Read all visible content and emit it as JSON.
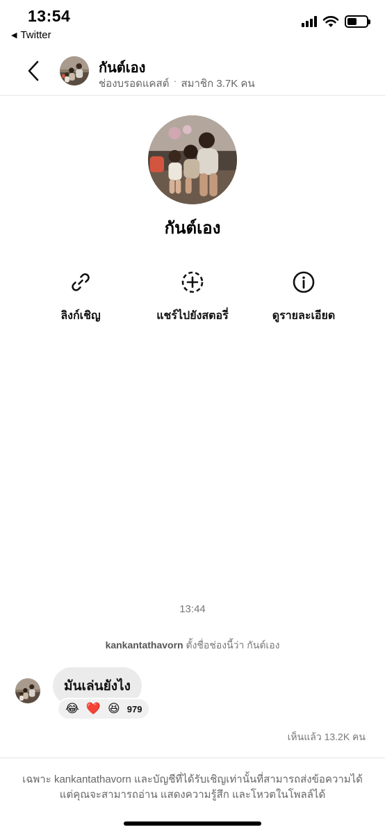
{
  "status_bar": {
    "time": "13:54",
    "back_app": "Twitter",
    "battery_level": 0.5
  },
  "header": {
    "title": "กันต์เอง",
    "subtitle_type": "ช่องบรอดแคสต์",
    "subtitle_members": "สมาชิก 3.7K คน"
  },
  "profile": {
    "name": "กันต์เอง"
  },
  "actions": [
    {
      "label": "ลิงก์เชิญ",
      "icon": "link-icon"
    },
    {
      "label": "แชร์ไปยังสตอรี่",
      "icon": "add-story-icon"
    },
    {
      "label": "ดูรายละเอียด",
      "icon": "info-icon"
    }
  ],
  "chat": {
    "time": "13:44",
    "system_user": "kankantathavorn",
    "system_text": " ตั้งชื่อช่องนี้ว่า กันต์เอง",
    "message": "มันเล่นยังไง",
    "reactions": {
      "emojis": [
        "😂",
        "❤️",
        "😆"
      ],
      "count": "979"
    },
    "seen": "เห็นแล้ว 13.2K คน"
  },
  "footer": {
    "line1": "เฉพาะ kankantathavorn และบัญชีที่ได้รับเชิญเท่านั้นที่สามารถส่งข้อความได้",
    "line2": "แต่คุณจะสามารถอ่าน แสดงความรู้สึก และโหวตในโพลล์ได้"
  }
}
